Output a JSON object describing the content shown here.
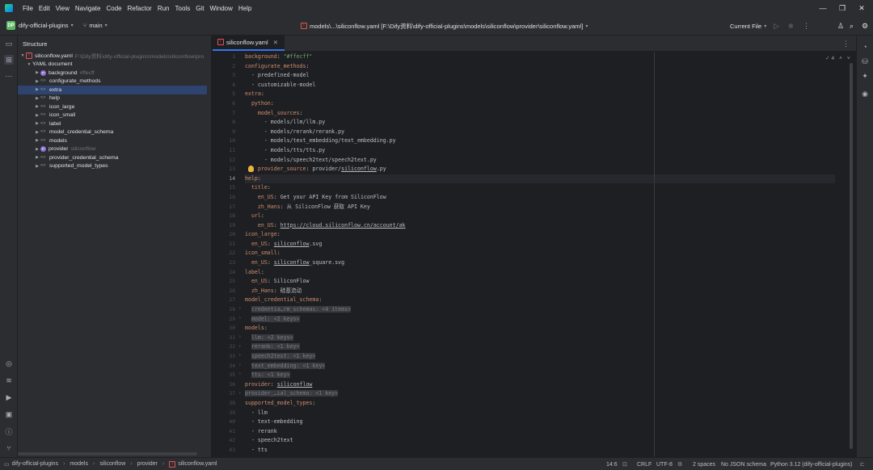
{
  "menubar": {
    "items": [
      "File",
      "Edit",
      "View",
      "Navigate",
      "Code",
      "Refactor",
      "Run",
      "Tools",
      "Git",
      "Window",
      "Help"
    ]
  },
  "toolbar": {
    "project_badge": "DP",
    "project_name": "dify-official-plugins",
    "branch": "main",
    "title": "models\\...\\siliconflow.yaml [F:\\Dify资料\\dify-official-plugins\\models\\siliconflow\\provider\\siliconflow.yaml]",
    "run_config": "Current File"
  },
  "structure": {
    "title": "Structure",
    "root_file": "siliconflow.yaml",
    "root_path": "F:\\Dify资料\\dify-official-plugins\\models\\siliconflow\\pro",
    "doc_label": "YAML document",
    "items": [
      {
        "label": "background",
        "hint": "#ffecff",
        "badge": "P"
      },
      {
        "label": "configurate_methods"
      },
      {
        "label": "extra",
        "selected": true
      },
      {
        "label": "help"
      },
      {
        "label": "icon_large"
      },
      {
        "label": "icon_small"
      },
      {
        "label": "label"
      },
      {
        "label": "model_credential_schema"
      },
      {
        "label": "models"
      },
      {
        "label": "provider",
        "hint": "siliconflow",
        "badge": "P"
      },
      {
        "label": "provider_credential_schema"
      },
      {
        "label": "supported_model_types"
      }
    ]
  },
  "editor": {
    "tab_label": "siliconflow.yaml",
    "inspections": "4",
    "line_numbers": [
      "1",
      "2",
      "3",
      "4",
      "5",
      "6",
      "7",
      "8",
      "9",
      "10",
      "11",
      "12",
      "13",
      "14",
      "15",
      "16",
      "17",
      "18",
      "19",
      "20",
      "21",
      "22",
      "23",
      "24",
      "25",
      "26",
      "27",
      "28",
      "29",
      "30",
      "31",
      "32",
      "33",
      "34",
      "35",
      "36",
      "37",
      "38",
      "39",
      "40",
      "41",
      "42",
      "43",
      "44"
    ],
    "code": {
      "l1k": "background",
      "l1v": "\"#ffecff\"",
      "l2k": "configurate_methods",
      "l3": "  - predefined-model",
      "l4": "  - customizable-model",
      "l5k": "extra",
      "l6k": "python",
      "l7k": "model_sources",
      "l8": "      - models/llm/llm.py",
      "l9": "      - models/rerank/rerank.py",
      "l10": "      - models/text_embedding/text_embedding.py",
      "l11": "      - models/tts/tts.py",
      "l12": "      - models/speech2text/speech2text.py",
      "l13k": "provider_source",
      "l13v_a": "provider/",
      "l13v_b": "siliconflow",
      "l13v_c": ".py",
      "l14k": "help",
      "l15k": "title",
      "l16k": "en_US",
      "l16v": "Get your API Key from SiliconFlow",
      "l17k": "zh_Hans",
      "l17v": "从 SiliconFlow 获取 API Key",
      "l18k": "url",
      "l19k": "en_US",
      "l19v": "https://cloud.siliconflow.cn/account/ak",
      "l20k": "icon_large",
      "l21k": "en_US",
      "l21v_a": "siliconflow",
      "l21v_b": ".svg",
      "l22k": "icon_small",
      "l23k": "en_US",
      "l23v_a": "siliconflow",
      "l23v_b": "_square.svg",
      "l24k": "label",
      "l25k": "en_US",
      "l25v": "SiliconFlow",
      "l26k": "zh_Hans",
      "l26v": "硅基流动",
      "l27k": "model_credential_schema",
      "l28f": "credentia…rm_schemas: <4 items>",
      "l29f": "model: <2 keys>",
      "l30k": "models",
      "l31f": "llm: <2 keys>",
      "l32f": "rerank: <1 key>",
      "l33f": "speech2text: <1 key>",
      "l34f": "text_embedding: <1 key>",
      "l35f": "tts: <1 key>",
      "l36k": "provider",
      "l36v": "siliconflow",
      "l37f": "provider_…ial_schema: <1 key>",
      "l38k": "supported_model_types",
      "l39": "  - llm",
      "l40": "  - text-embedding",
      "l41": "  - rerank",
      "l42": "  - speech2text",
      "l43": "  - tts"
    }
  },
  "statusbar": {
    "breadcrumbs": [
      "dify-official-plugins",
      "models",
      "siliconflow",
      "provider",
      "siliconflow.yaml"
    ],
    "position": "14:6",
    "line_sep": "CRLF",
    "encoding": "UTF-8",
    "indent": "2 spaces",
    "schema": "No JSON schema",
    "interpreter": "Python 3.12 (dify-official-plugins)"
  }
}
